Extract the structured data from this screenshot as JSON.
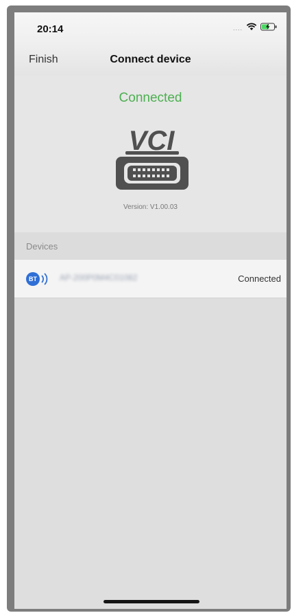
{
  "status_bar": {
    "time": "20:14",
    "signal": "....",
    "icons": [
      "wifi-icon",
      "battery-charging-icon"
    ]
  },
  "nav": {
    "back_label": "Finish",
    "title": "Connect device"
  },
  "vci": {
    "status": "Connected",
    "status_color": "#4caf50",
    "logo_text": "VCI",
    "version": "Version: V1.00.03"
  },
  "devices": {
    "section_title": "Devices",
    "items": [
      {
        "badge": "BT",
        "name": "AP-200P0M4C01082",
        "status": "Connected",
        "icon": "bluetooth-icon"
      }
    ]
  }
}
